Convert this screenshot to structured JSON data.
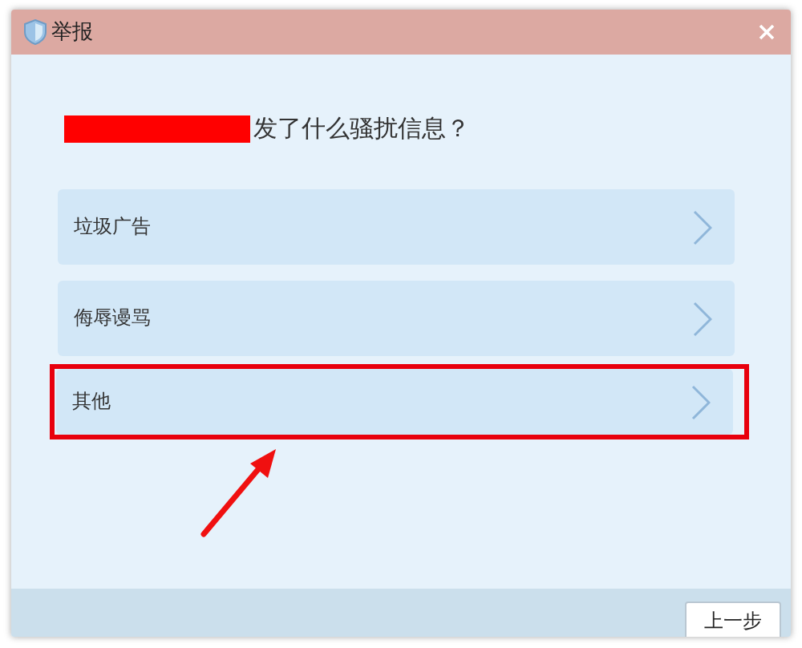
{
  "window": {
    "title": "举报"
  },
  "question": {
    "redacted": true,
    "text": "发了什么骚扰信息？"
  },
  "options": [
    {
      "label": "垃圾广告",
      "highlighted": false
    },
    {
      "label": "侮辱谩骂",
      "highlighted": false
    },
    {
      "label": "其他",
      "highlighted": true
    }
  ],
  "annotation_arrow": true,
  "buttons": [
    "上一步"
  ]
}
